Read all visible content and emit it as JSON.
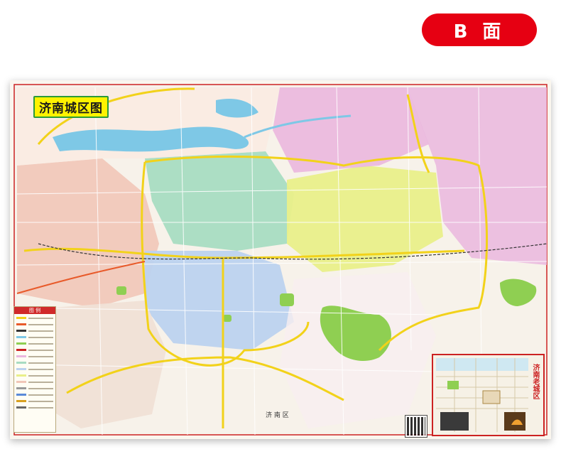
{
  "badge": {
    "label": "B 面"
  },
  "map": {
    "title": "济南城区图",
    "icon": "map-sheet",
    "colors": {
      "lake_river": "#7ec8e6",
      "district_green": "#a8dcc2",
      "district_yellow": "#e9ef8a",
      "district_pink": "#eab7de",
      "district_blue": "#bcd2ef",
      "district_peach": "#f1c6b8",
      "ring_road": "#f2d21a",
      "park": "#8fcf52",
      "border": "#cc2222"
    }
  },
  "legend": {
    "heading": "图 例"
  },
  "inset": {
    "title": "济南老城区"
  },
  "labels": {
    "district_south": "济 南 区"
  }
}
